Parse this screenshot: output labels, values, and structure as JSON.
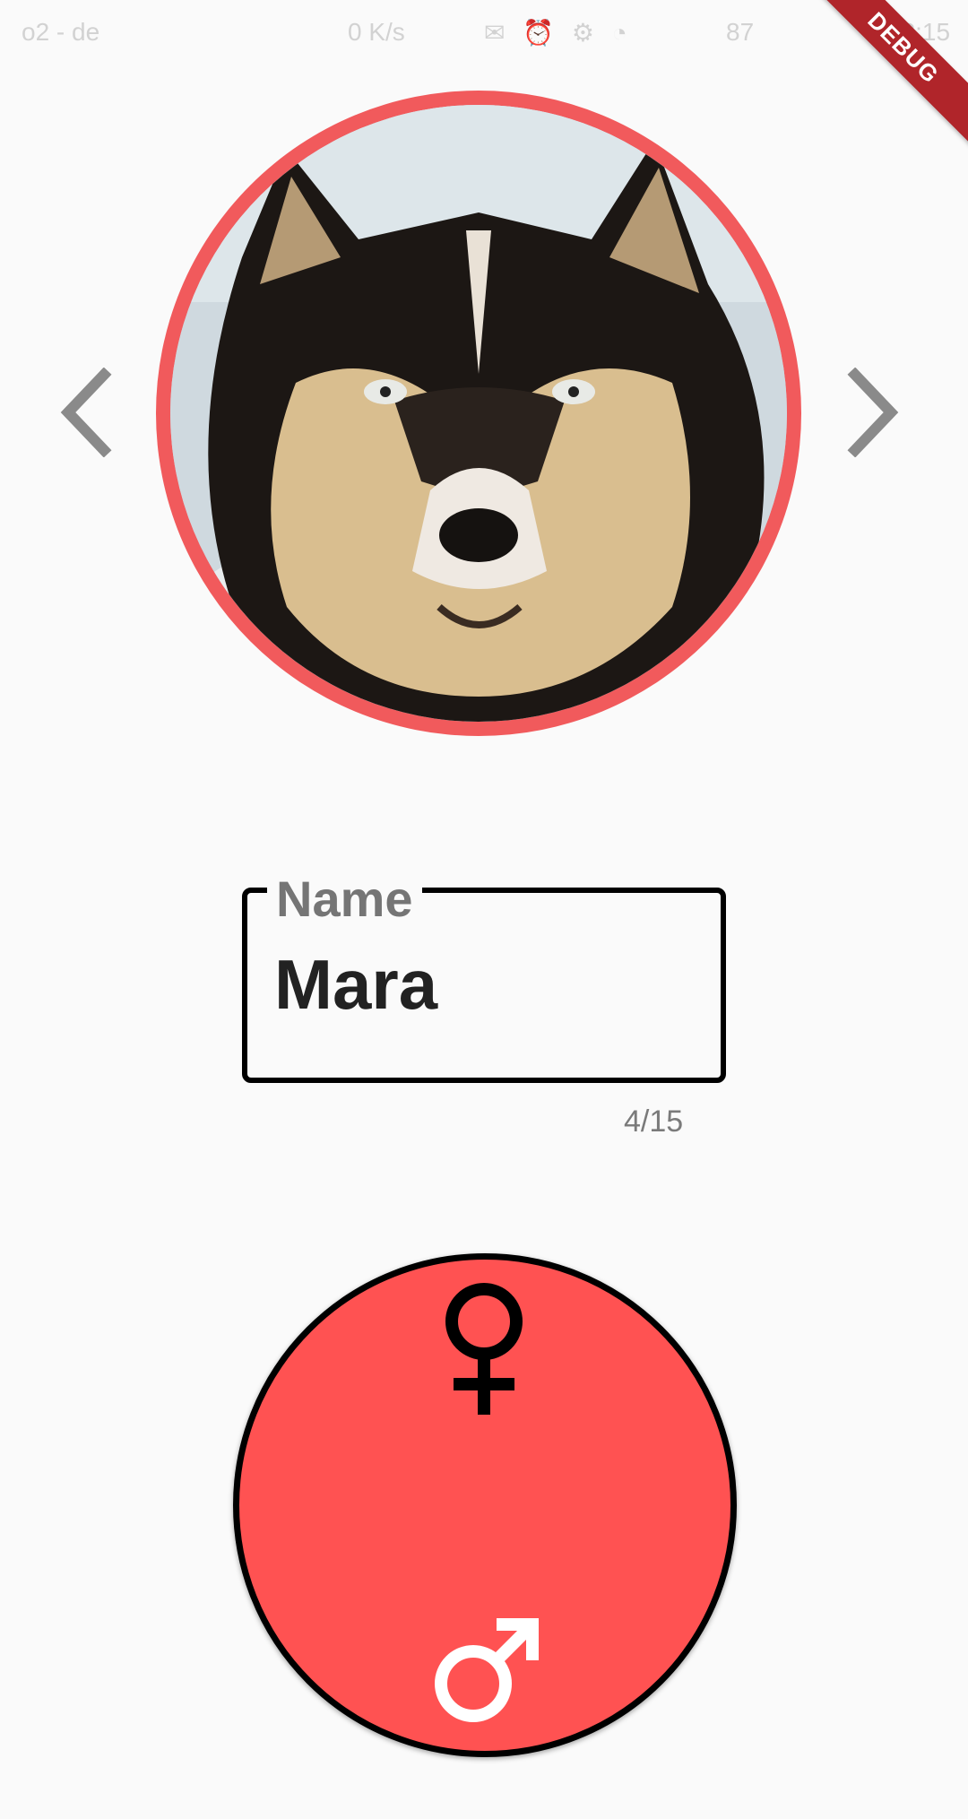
{
  "status_bar": {
    "left_text": "o2 - de",
    "network_speed": "0 K/s",
    "battery": "87",
    "time": "18:15"
  },
  "debug_banner": "DEBUG",
  "profile": {
    "photo_alt": "husky",
    "ring_color": "#f15a5c"
  },
  "name_field": {
    "label": "Name",
    "value": "Mara",
    "counter": "4/15"
  },
  "gender_toggle": {
    "fill_color": "#ff5252",
    "top_icon": "female-icon",
    "bottom_icon": "male-icon"
  }
}
